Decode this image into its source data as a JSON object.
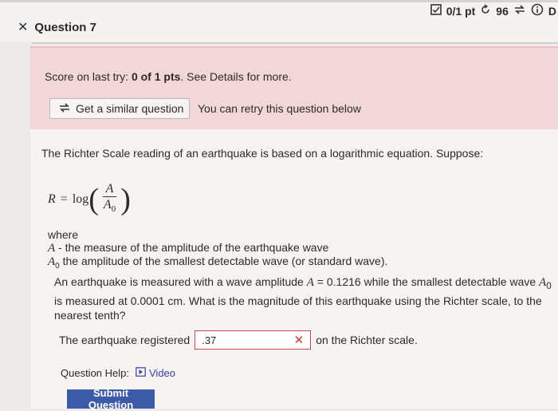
{
  "header": {
    "question_title": "Question 7",
    "score_label": "0/1 pt",
    "retries_count": "96",
    "details_letter": "D"
  },
  "feedback": {
    "score_prefix": "Score on last try: ",
    "score_value": "0 of 1 pts",
    "score_suffix": ". See Details for more.",
    "similar_button": "Get a similar question",
    "retry_note": "You can retry this question below"
  },
  "question": {
    "statement": "The Richter Scale reading of an earthquake is based on a logarithmic equation. Suppose:",
    "formula": {
      "lhs": "R",
      "eq": "=",
      "func": "log",
      "numerator": "A",
      "denominator": "A",
      "denominator_sub": "0"
    },
    "where_label": "where",
    "def_a_var": "A",
    "def_a_text": " - the measure of the amplitude of the earthquake wave",
    "def_a0_var": "A",
    "def_a0_sub": "0",
    "def_a0_text": " the amplitude of the smallest detectable wave (or standard wave).",
    "problem_part1": "An earthquake is measured with a wave amplitude ",
    "problem_var": "A",
    "problem_eq": " = ",
    "problem_part2": " 0.1216 while the smallest detectable wave ",
    "problem_var2": "A",
    "problem_var2_sub": "0",
    "problem_part3": " is measured at 0.0001 cm. What is the magnitude of this earthquake using the Richter scale, to the nearest tenth?"
  },
  "answer": {
    "prefix": "The earthquake registered",
    "value": ".37",
    "suffix": "on the Richter scale."
  },
  "help": {
    "label": "Question Help:",
    "video": "Video"
  },
  "submit": {
    "label": "Submit Question"
  },
  "colors": {
    "feedback_bg": "#f1d7d8",
    "submit_bg": "#3d5aa6",
    "error": "#c9494e"
  }
}
